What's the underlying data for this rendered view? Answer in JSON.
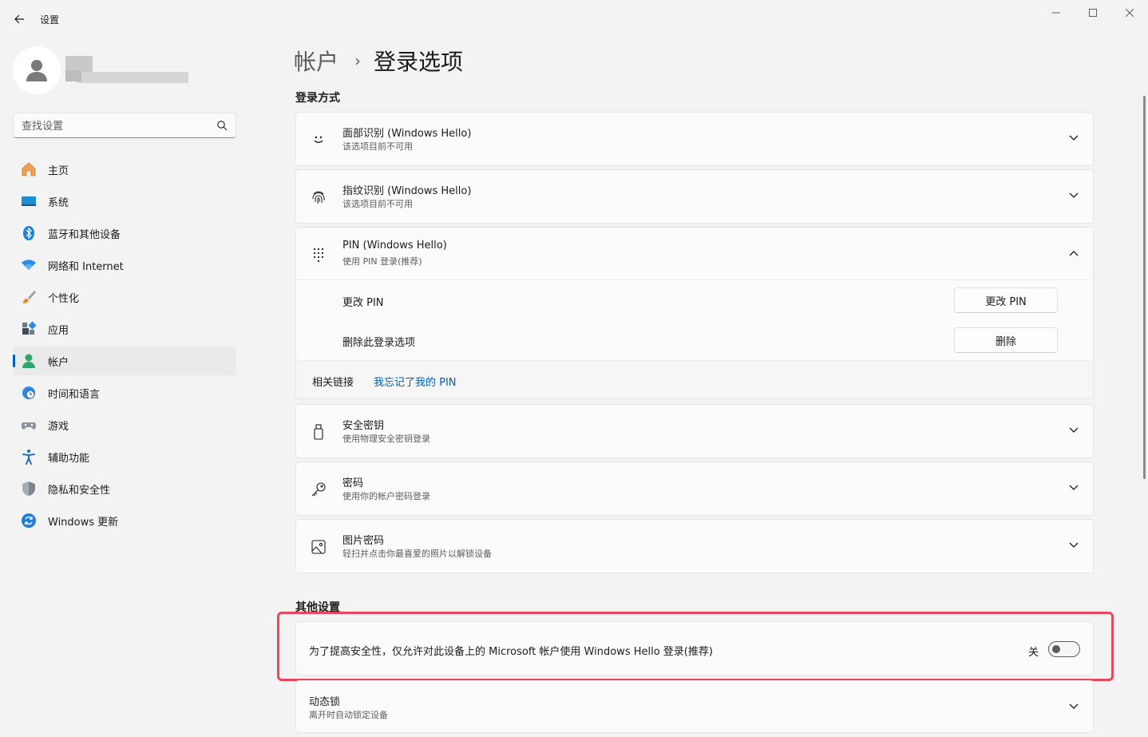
{
  "window": {
    "title": "设置",
    "back_icon": "back-arrow-icon",
    "minimize_icon": "minimize-icon",
    "maximize_icon": "maximize-icon",
    "close_icon": "close-icon"
  },
  "search": {
    "placeholder": "查找设置"
  },
  "sidebar": {
    "items": [
      {
        "label": "主页",
        "icon": "home-icon"
      },
      {
        "label": "系统",
        "icon": "system-icon"
      },
      {
        "label": "蓝牙和其他设备",
        "icon": "bluetooth-icon"
      },
      {
        "label": "网络和 Internet",
        "icon": "wifi-icon"
      },
      {
        "label": "个性化",
        "icon": "brush-icon"
      },
      {
        "label": "应用",
        "icon": "apps-icon"
      },
      {
        "label": "帐户",
        "icon": "account-icon",
        "active": true
      },
      {
        "label": "时间和语言",
        "icon": "clock-globe-icon"
      },
      {
        "label": "游戏",
        "icon": "gamepad-icon"
      },
      {
        "label": "辅助功能",
        "icon": "accessibility-icon"
      },
      {
        "label": "隐私和安全性",
        "icon": "shield-icon"
      },
      {
        "label": "Windows 更新",
        "icon": "update-icon"
      }
    ]
  },
  "breadcrumb": {
    "parent": "帐户",
    "separator": "›",
    "current": "登录选项"
  },
  "sections": {
    "signin_title": "登录方式",
    "other_title": "其他设置"
  },
  "signin": {
    "face": {
      "title": "面部识别 (Windows Hello)",
      "subtitle": "该选项目前不可用",
      "icon": "face-icon"
    },
    "fingerprint": {
      "title": "指纹识别 (Windows Hello)",
      "subtitle": "该选项目前不可用",
      "icon": "fingerprint-icon"
    },
    "pin": {
      "title": "PIN (Windows Hello)",
      "subtitle": "使用 PIN 登录(推荐)",
      "icon": "keypad-icon",
      "change_label": "更改 PIN",
      "change_button": "更改 PIN",
      "remove_label": "删除此登录选项",
      "remove_button": "删除",
      "related_label": "相关链接",
      "related_link": "我忘记了我的 PIN"
    },
    "security_key": {
      "title": "安全密钥",
      "subtitle": "使用物理安全密钥登录",
      "icon": "usb-key-icon"
    },
    "password": {
      "title": "密码",
      "subtitle": "使用你的帐户密码登录",
      "icon": "key-icon"
    },
    "picture_password": {
      "title": "图片密码",
      "subtitle": "轻扫并点击你最喜爱的照片以解锁设备",
      "icon": "picture-icon"
    }
  },
  "other": {
    "hello_only": {
      "title": "为了提高安全性，仅允许对此设备上的 Microsoft 帐户使用 Windows Hello 登录(推荐)",
      "state_label": "关",
      "on": false
    },
    "dynamic_lock": {
      "title": "动态锁",
      "subtitle": "离开时自动锁定设备"
    }
  },
  "colors": {
    "accent": "#005fb8",
    "highlight": "#e8475f",
    "background": "#f3f3f3",
    "card": "#fbfbfb"
  }
}
